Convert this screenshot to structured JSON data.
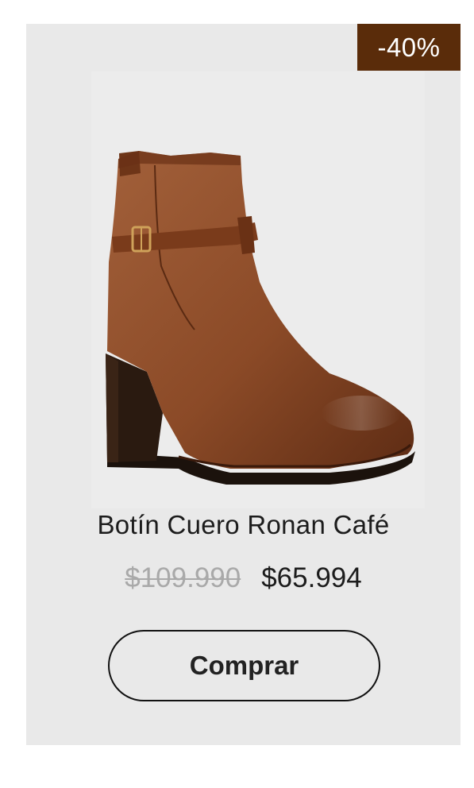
{
  "product": {
    "discount_badge": "-40%",
    "name": "Botín Cuero Ronan Café",
    "original_price": "$109.990",
    "sale_price": "$65.994",
    "buy_label": "Comprar",
    "image_icon": "ankle-boot-image"
  },
  "colors": {
    "card_background": "#e9e9e9",
    "badge_background": "#5a2c0a",
    "boot_leather": "#8b4a27",
    "old_price": "#a9a9a9"
  }
}
